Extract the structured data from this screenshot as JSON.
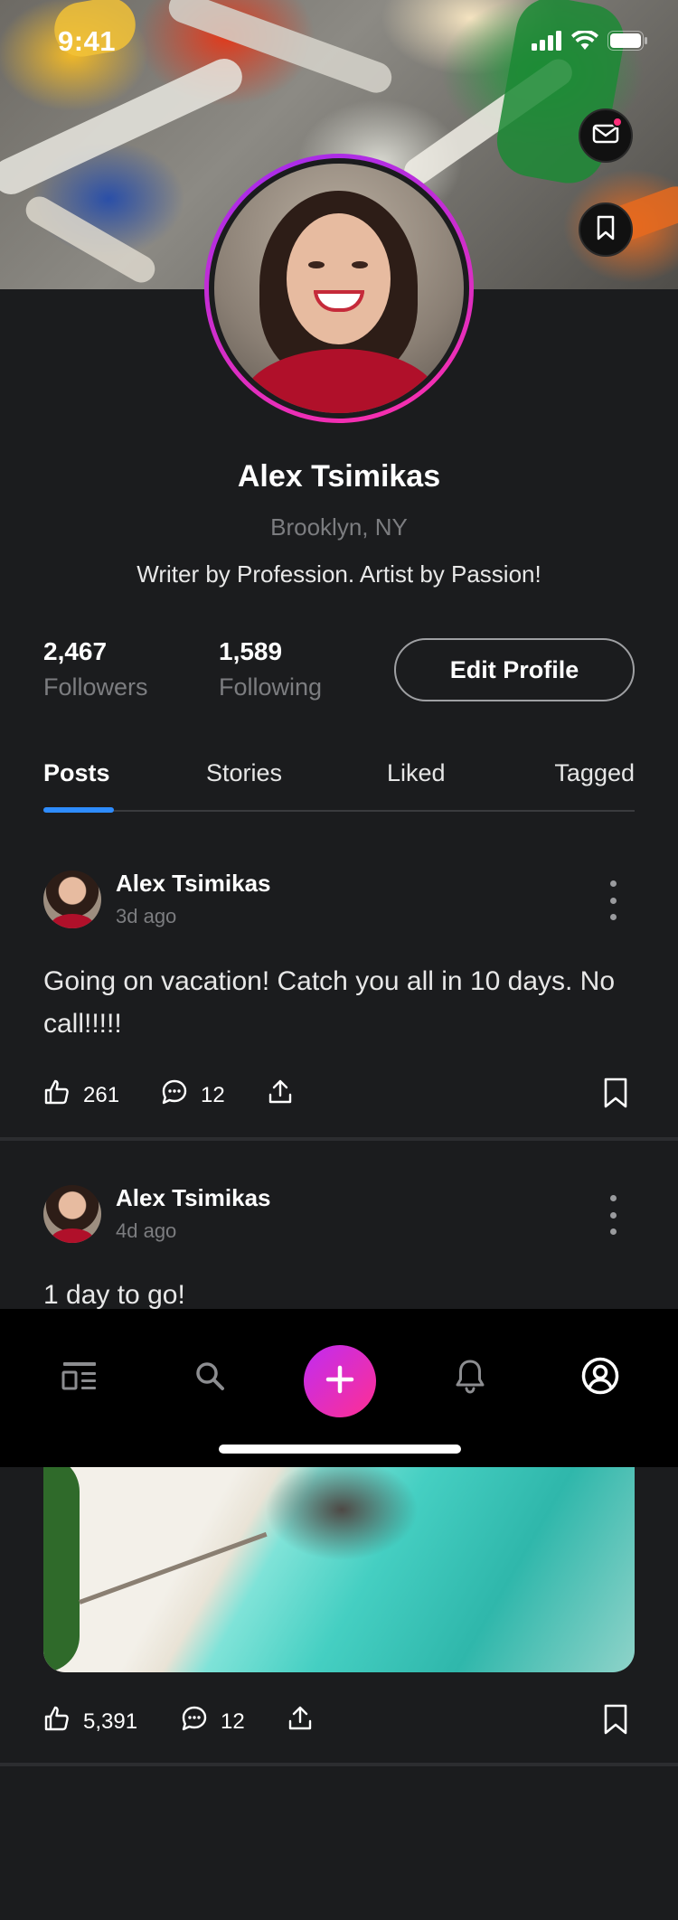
{
  "status_bar": {
    "time": "9:41"
  },
  "profile": {
    "name": "Alex Tsimikas",
    "location": "Brooklyn, NY",
    "bio": "Writer by Profession. Artist by Passion!",
    "followers_count": "2,467",
    "followers_label": "Followers",
    "following_count": "1,589",
    "following_label": "Following",
    "edit_label": "Edit Profile"
  },
  "tabs": [
    {
      "label": "Posts",
      "active": true
    },
    {
      "label": "Stories",
      "active": false
    },
    {
      "label": "Liked",
      "active": false
    },
    {
      "label": "Tagged",
      "active": false
    }
  ],
  "posts": [
    {
      "author": "Alex Tsimikas",
      "time": "3d ago",
      "text": "Going on vacation! Catch you all in 10 days. No call!!!!!",
      "likes": "261",
      "comments": "12"
    },
    {
      "author": "Alex Tsimikas",
      "time": "4d ago",
      "text": "1 day to go!",
      "likes": "5,391",
      "comments": "12"
    }
  ],
  "bottom_nav": {
    "items": [
      "feed-icon",
      "search-icon",
      "add-icon",
      "bell-icon",
      "profile-icon"
    ],
    "active": "profile-icon"
  },
  "colors": {
    "background": "#1b1c1e",
    "accent_blue": "#2e8cff",
    "avatar_ring_start": "#a02cf0",
    "avatar_ring_end": "#ff2fa8",
    "add_button": "#ff2f92",
    "muted_text": "#7c7d80"
  }
}
